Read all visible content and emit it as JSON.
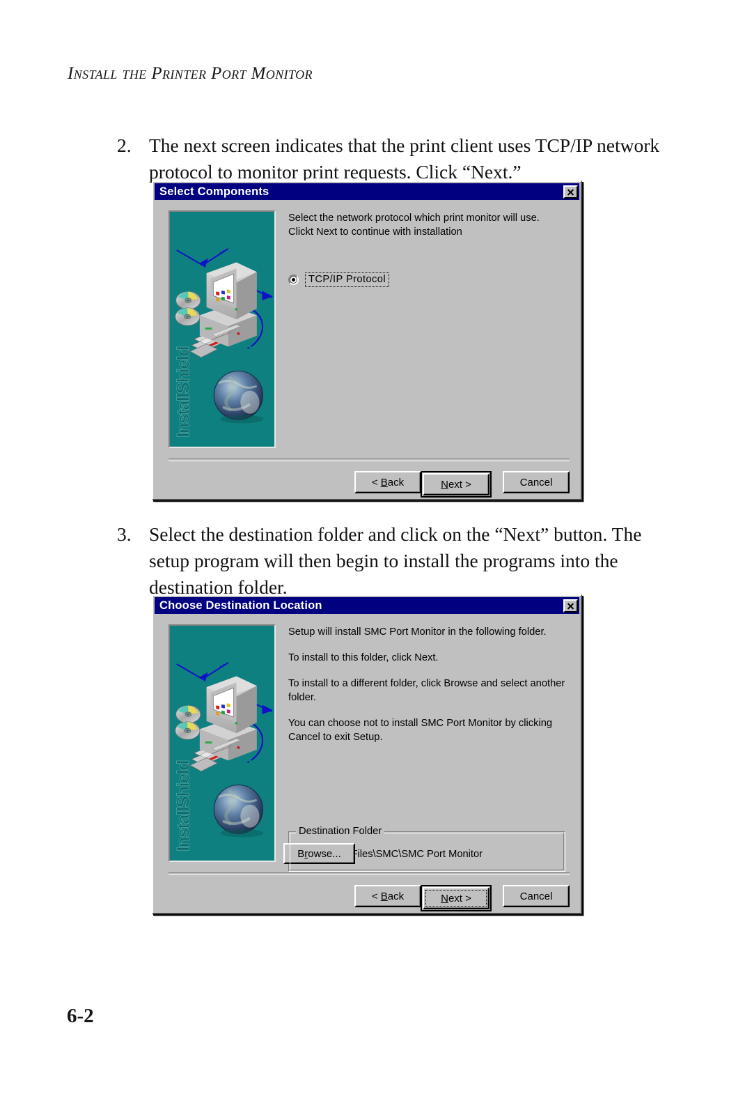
{
  "page": {
    "header": "Install the Printer Port Monitor",
    "number": "6-2"
  },
  "steps": [
    {
      "number": "2.",
      "text": "The next screen indicates that the print client uses TCP/IP network protocol to monitor print requests. Click “Next.”"
    },
    {
      "number": "3.",
      "text": "Select the destination folder and click on the “Next” button. The setup program will then begin to install the programs into the destination folder."
    }
  ],
  "dialog_select_components": {
    "title": "Select Components",
    "close_label": "x",
    "artwork_label": "InstallShield",
    "body_lines": [
      "Select the network protocol which print monitor will use.",
      "Clickt Next to continue with installation"
    ],
    "radio": {
      "label": "TCP/IP Protocol",
      "selected": true
    },
    "buttons": {
      "back": "< Back",
      "back_accel": "B",
      "next": "Next >",
      "next_accel": "N",
      "cancel": "Cancel"
    }
  },
  "dialog_choose_destination": {
    "title": "Choose Destination Location",
    "close_label": "x",
    "artwork_label": "InstallShield",
    "body_paragraphs": [
      "Setup will install SMC Port Monitor in the following folder.",
      "To install to this folder, click Next.",
      "To install to a different folder, click Browse and select another folder.",
      "You can choose not to install SMC Port Monitor by clicking Cancel to exit Setup."
    ],
    "group": {
      "title": "Destination Folder",
      "path": "F:\\Program Files\\SMC\\SMC Port Monitor",
      "browse": "Browse...",
      "browse_accel": "r"
    },
    "buttons": {
      "back": "< Back",
      "back_accel": "B",
      "next": "Next >",
      "next_accel": "N",
      "cancel": "Cancel"
    }
  },
  "colors": {
    "titlebar": "#000080",
    "dialog_face": "#c0c0c0",
    "artwork_background": "#0f8080",
    "page_background": "#ffffff"
  }
}
